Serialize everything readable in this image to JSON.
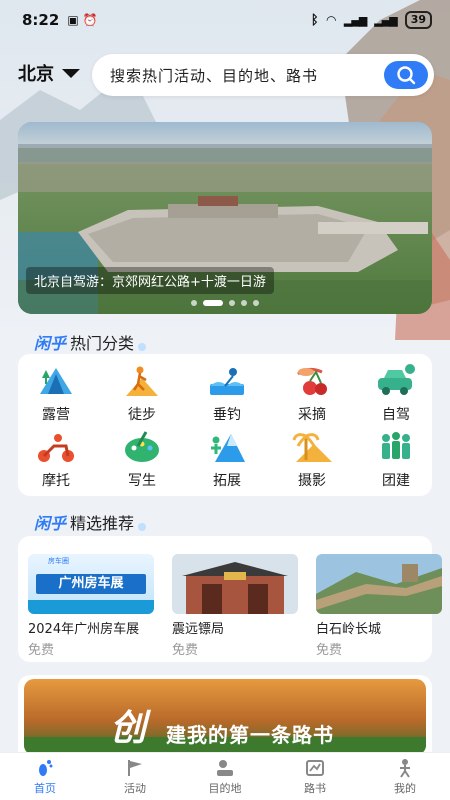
{
  "status": {
    "time": "8:22",
    "battery": "39"
  },
  "location": {
    "city": "北京"
  },
  "search": {
    "placeholder": "搜索热门活动、目的地、路书"
  },
  "banner": {
    "caption": "北京自驾游：京郊网红公路+十渡一日游",
    "slides": 5,
    "active_slide": 1
  },
  "hot": {
    "logo": "闲乎",
    "title": "热门分类",
    "items": [
      {
        "label": "露营",
        "icon": "tent-icon"
      },
      {
        "label": "徒步",
        "icon": "hiking-icon"
      },
      {
        "label": "垂钓",
        "icon": "fishing-icon"
      },
      {
        "label": "采摘",
        "icon": "cherry-icon"
      },
      {
        "label": "自驾",
        "icon": "car-icon",
        "badge": "自"
      },
      {
        "label": "摩托",
        "icon": "motorcycle-icon"
      },
      {
        "label": "写生",
        "icon": "palette-icon"
      },
      {
        "label": "拓展",
        "icon": "outdoor-expansion-icon"
      },
      {
        "label": "摄影",
        "icon": "palm-camera-icon"
      },
      {
        "label": "团建",
        "icon": "team-building-icon"
      }
    ]
  },
  "recommend": {
    "logo": "闲乎",
    "title": "精选推荐",
    "items": [
      {
        "title": "2024年广州房车展",
        "price": "免费",
        "img_text": "广州房车展",
        "img_sub": "房车圈"
      },
      {
        "title": "震远镖局",
        "price": "免费"
      },
      {
        "title": "白石岭长城",
        "price": "免费"
      }
    ]
  },
  "create": {
    "big_char": "创",
    "text": "建我的第一条路书"
  },
  "tabs": [
    {
      "label": "首页",
      "icon": "footprint-icon",
      "active": true
    },
    {
      "label": "活动",
      "icon": "flag-icon",
      "active": false
    },
    {
      "label": "目的地",
      "icon": "destination-icon",
      "active": false
    },
    {
      "label": "路书",
      "icon": "map-book-icon",
      "active": false
    },
    {
      "label": "我的",
      "icon": "person-icon",
      "active": false
    }
  ],
  "colors": {
    "accent": "#2f7cf6",
    "card": "#ffffff",
    "background": "#eef1f6"
  }
}
